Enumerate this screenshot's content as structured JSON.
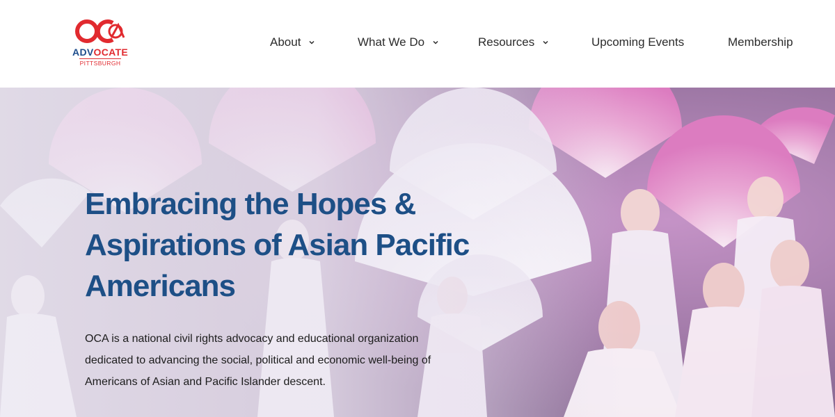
{
  "logo": {
    "word_a": "ADV",
    "word_b": "OCATE",
    "subtitle": "PITTSBURGH",
    "colors": {
      "red": "#e12a2f",
      "blue": "#1e4d8c"
    }
  },
  "nav": {
    "items": [
      {
        "label": "About",
        "has_dropdown": true,
        "icon": "chevron-down-icon"
      },
      {
        "label": "What We Do",
        "has_dropdown": true,
        "icon": "chevron-down-icon"
      },
      {
        "label": "Resources",
        "has_dropdown": true,
        "icon": "chevron-down-icon"
      },
      {
        "label": "Upcoming Events",
        "has_dropdown": false
      },
      {
        "label": "Membership",
        "has_dropdown": false
      }
    ]
  },
  "hero": {
    "title_lines": [
      "Embracing the Hopes &",
      "Aspirations of Asian Pacific",
      "Americans"
    ],
    "body_lines": [
      "OCA is a national civil rights advocacy and educational organization",
      "dedicated to advancing the social, political and economic well-being of",
      "Americans of Asian and Pacific Islander descent."
    ],
    "colors": {
      "title": "#1d4f86",
      "body": "#1c1c1c"
    }
  }
}
